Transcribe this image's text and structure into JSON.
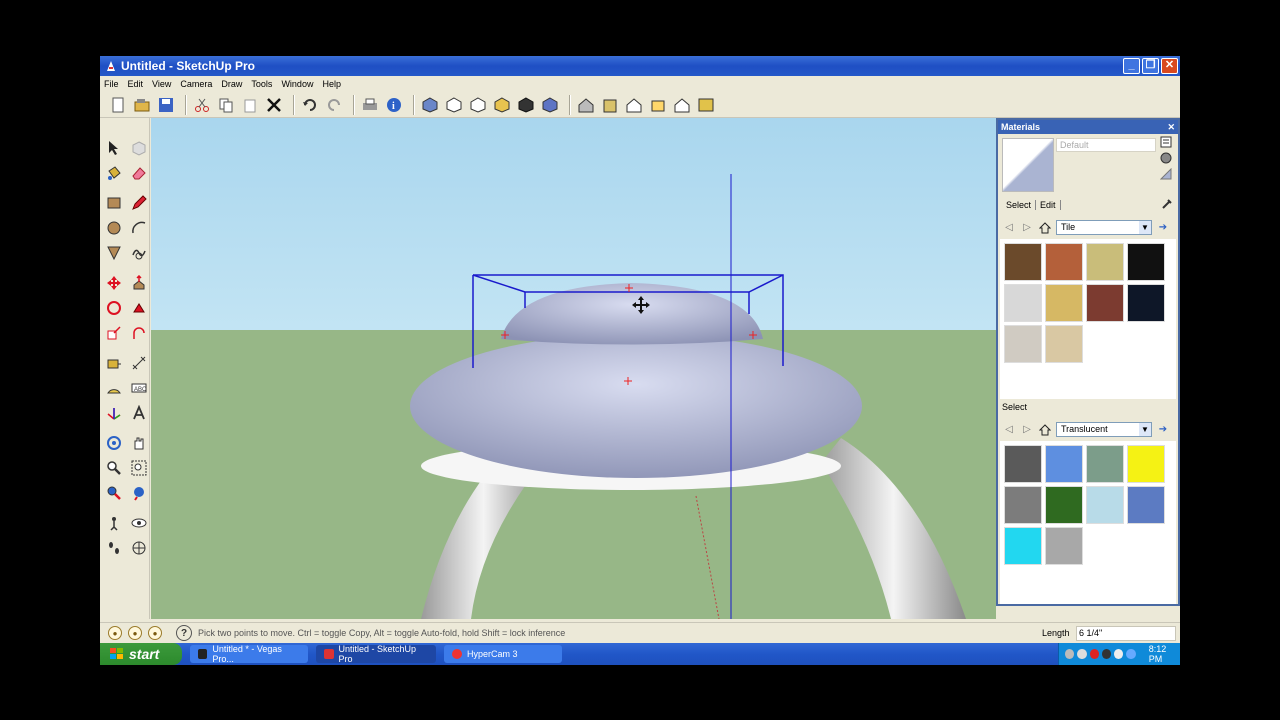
{
  "window": {
    "title": "Untitled - SketchUp Pro"
  },
  "menu": [
    "File",
    "Edit",
    "View",
    "Camera",
    "Draw",
    "Tools",
    "Window",
    "Help"
  ],
  "toolbar_icons": [
    "new-icon",
    "open-icon",
    "save-icon",
    "cut-icon",
    "copy-icon",
    "paste-icon",
    "erase-icon",
    "undo-icon",
    "redo-icon",
    "print-icon",
    "model-info-icon",
    "iso-view-icon",
    "top-view-icon",
    "front-view-icon",
    "right-view-icon",
    "back-view-icon",
    "left-view-icon",
    "xray-icon",
    "wireframe-icon",
    "hidden-line-icon",
    "shaded-icon",
    "textured-icon"
  ],
  "materials_panel": {
    "title": "Materials",
    "material_name_placeholder": "Default",
    "tabs": [
      "Select",
      "Edit"
    ],
    "library_top": "Tile",
    "select_label": "Select",
    "library_bottom": "Translucent",
    "tile_swatches": [
      "#6b4a2b",
      "#b4603a",
      "#c9bd7a",
      "#111111",
      "#d8d8d8",
      "#d6b864",
      "#7c3b30",
      "#0e1728",
      "#d0cbc2",
      "#d9c8a3"
    ],
    "translucent_swatches": [
      "#5a5a5a",
      "#5e8fe0",
      "#7c9d8a",
      "#f5f214",
      "#7c7c7c",
      "#2f6a20",
      "#b8dbe8",
      "#5c7bc2",
      "#22d7f0",
      "#a8a8a8"
    ]
  },
  "status": {
    "message": "Pick two points to move.  Ctrl = toggle Copy, Alt = toggle Auto-fold, hold Shift = lock inference",
    "length_label": "Length",
    "length_value": "6 1/4\""
  },
  "taskbar": {
    "start": "start",
    "tasks": [
      "Untitled * - Vegas Pro...",
      "Untitled - SketchUp Pro",
      "HyperCam 3"
    ],
    "clock": "8:12 PM"
  }
}
